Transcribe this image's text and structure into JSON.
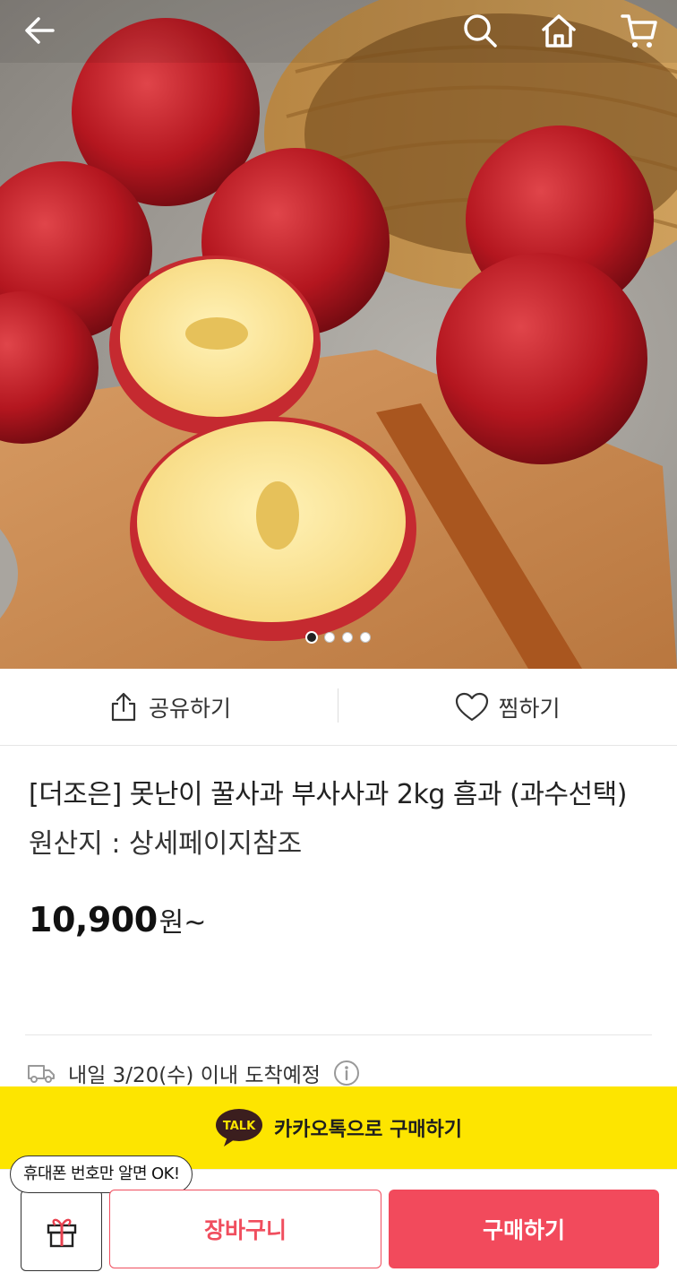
{
  "nav": {
    "back_icon": "back-arrow-icon",
    "search_icon": "search-icon",
    "home_icon": "home-icon",
    "cart_icon": "cart-icon"
  },
  "carousel": {
    "image_count": 4,
    "active_index": 0
  },
  "actions": {
    "share_label": "공유하기",
    "wish_label": "찜하기"
  },
  "product": {
    "title": "[더조은] 못난이 꿀사과 부사사과 2kg 흠과 (과수선택)",
    "origin": "원산지 : 상세페이지참조",
    "price_value": "10,900",
    "price_unit": "원~"
  },
  "delivery": {
    "text": "내일 3/20(수) 이내 도착예정"
  },
  "kakao": {
    "badge": "TALK",
    "label": "카카오톡으로 구매하기"
  },
  "bottom_bar": {
    "tooltip": "휴대폰 번호만 알면 OK!",
    "cart_label": "장바구니",
    "buy_label": "구매하기"
  },
  "colors": {
    "accent": "#f24a5c",
    "kakao": "#fde500"
  }
}
